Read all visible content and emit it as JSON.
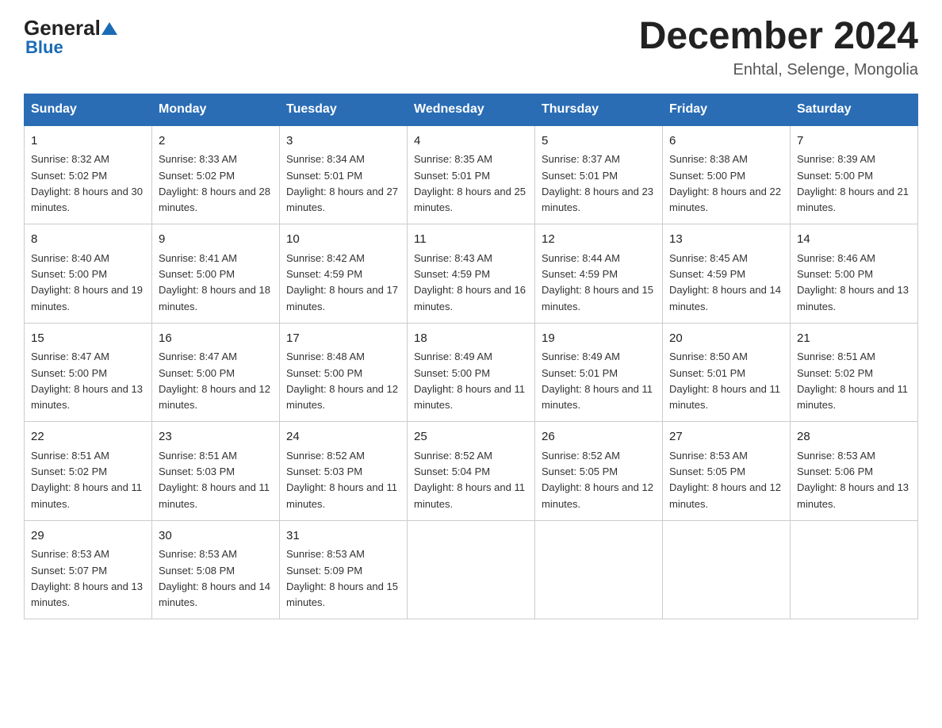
{
  "logo": {
    "general": "General",
    "blue": "Blue"
  },
  "header": {
    "month_title": "December 2024",
    "subtitle": "Enhtal, Selenge, Mongolia"
  },
  "weekdays": [
    "Sunday",
    "Monday",
    "Tuesday",
    "Wednesday",
    "Thursday",
    "Friday",
    "Saturday"
  ],
  "weeks": [
    [
      {
        "day": "1",
        "sunrise": "8:32 AM",
        "sunset": "5:02 PM",
        "daylight": "8 hours and 30 minutes."
      },
      {
        "day": "2",
        "sunrise": "8:33 AM",
        "sunset": "5:02 PM",
        "daylight": "8 hours and 28 minutes."
      },
      {
        "day": "3",
        "sunrise": "8:34 AM",
        "sunset": "5:01 PM",
        "daylight": "8 hours and 27 minutes."
      },
      {
        "day": "4",
        "sunrise": "8:35 AM",
        "sunset": "5:01 PM",
        "daylight": "8 hours and 25 minutes."
      },
      {
        "day": "5",
        "sunrise": "8:37 AM",
        "sunset": "5:01 PM",
        "daylight": "8 hours and 23 minutes."
      },
      {
        "day": "6",
        "sunrise": "8:38 AM",
        "sunset": "5:00 PM",
        "daylight": "8 hours and 22 minutes."
      },
      {
        "day": "7",
        "sunrise": "8:39 AM",
        "sunset": "5:00 PM",
        "daylight": "8 hours and 21 minutes."
      }
    ],
    [
      {
        "day": "8",
        "sunrise": "8:40 AM",
        "sunset": "5:00 PM",
        "daylight": "8 hours and 19 minutes."
      },
      {
        "day": "9",
        "sunrise": "8:41 AM",
        "sunset": "5:00 PM",
        "daylight": "8 hours and 18 minutes."
      },
      {
        "day": "10",
        "sunrise": "8:42 AM",
        "sunset": "4:59 PM",
        "daylight": "8 hours and 17 minutes."
      },
      {
        "day": "11",
        "sunrise": "8:43 AM",
        "sunset": "4:59 PM",
        "daylight": "8 hours and 16 minutes."
      },
      {
        "day": "12",
        "sunrise": "8:44 AM",
        "sunset": "4:59 PM",
        "daylight": "8 hours and 15 minutes."
      },
      {
        "day": "13",
        "sunrise": "8:45 AM",
        "sunset": "4:59 PM",
        "daylight": "8 hours and 14 minutes."
      },
      {
        "day": "14",
        "sunrise": "8:46 AM",
        "sunset": "5:00 PM",
        "daylight": "8 hours and 13 minutes."
      }
    ],
    [
      {
        "day": "15",
        "sunrise": "8:47 AM",
        "sunset": "5:00 PM",
        "daylight": "8 hours and 13 minutes."
      },
      {
        "day": "16",
        "sunrise": "8:47 AM",
        "sunset": "5:00 PM",
        "daylight": "8 hours and 12 minutes."
      },
      {
        "day": "17",
        "sunrise": "8:48 AM",
        "sunset": "5:00 PM",
        "daylight": "8 hours and 12 minutes."
      },
      {
        "day": "18",
        "sunrise": "8:49 AM",
        "sunset": "5:00 PM",
        "daylight": "8 hours and 11 minutes."
      },
      {
        "day": "19",
        "sunrise": "8:49 AM",
        "sunset": "5:01 PM",
        "daylight": "8 hours and 11 minutes."
      },
      {
        "day": "20",
        "sunrise": "8:50 AM",
        "sunset": "5:01 PM",
        "daylight": "8 hours and 11 minutes."
      },
      {
        "day": "21",
        "sunrise": "8:51 AM",
        "sunset": "5:02 PM",
        "daylight": "8 hours and 11 minutes."
      }
    ],
    [
      {
        "day": "22",
        "sunrise": "8:51 AM",
        "sunset": "5:02 PM",
        "daylight": "8 hours and 11 minutes."
      },
      {
        "day": "23",
        "sunrise": "8:51 AM",
        "sunset": "5:03 PM",
        "daylight": "8 hours and 11 minutes."
      },
      {
        "day": "24",
        "sunrise": "8:52 AM",
        "sunset": "5:03 PM",
        "daylight": "8 hours and 11 minutes."
      },
      {
        "day": "25",
        "sunrise": "8:52 AM",
        "sunset": "5:04 PM",
        "daylight": "8 hours and 11 minutes."
      },
      {
        "day": "26",
        "sunrise": "8:52 AM",
        "sunset": "5:05 PM",
        "daylight": "8 hours and 12 minutes."
      },
      {
        "day": "27",
        "sunrise": "8:53 AM",
        "sunset": "5:05 PM",
        "daylight": "8 hours and 12 minutes."
      },
      {
        "day": "28",
        "sunrise": "8:53 AM",
        "sunset": "5:06 PM",
        "daylight": "8 hours and 13 minutes."
      }
    ],
    [
      {
        "day": "29",
        "sunrise": "8:53 AM",
        "sunset": "5:07 PM",
        "daylight": "8 hours and 13 minutes."
      },
      {
        "day": "30",
        "sunrise": "8:53 AM",
        "sunset": "5:08 PM",
        "daylight": "8 hours and 14 minutes."
      },
      {
        "day": "31",
        "sunrise": "8:53 AM",
        "sunset": "5:09 PM",
        "daylight": "8 hours and 15 minutes."
      },
      null,
      null,
      null,
      null
    ]
  ]
}
